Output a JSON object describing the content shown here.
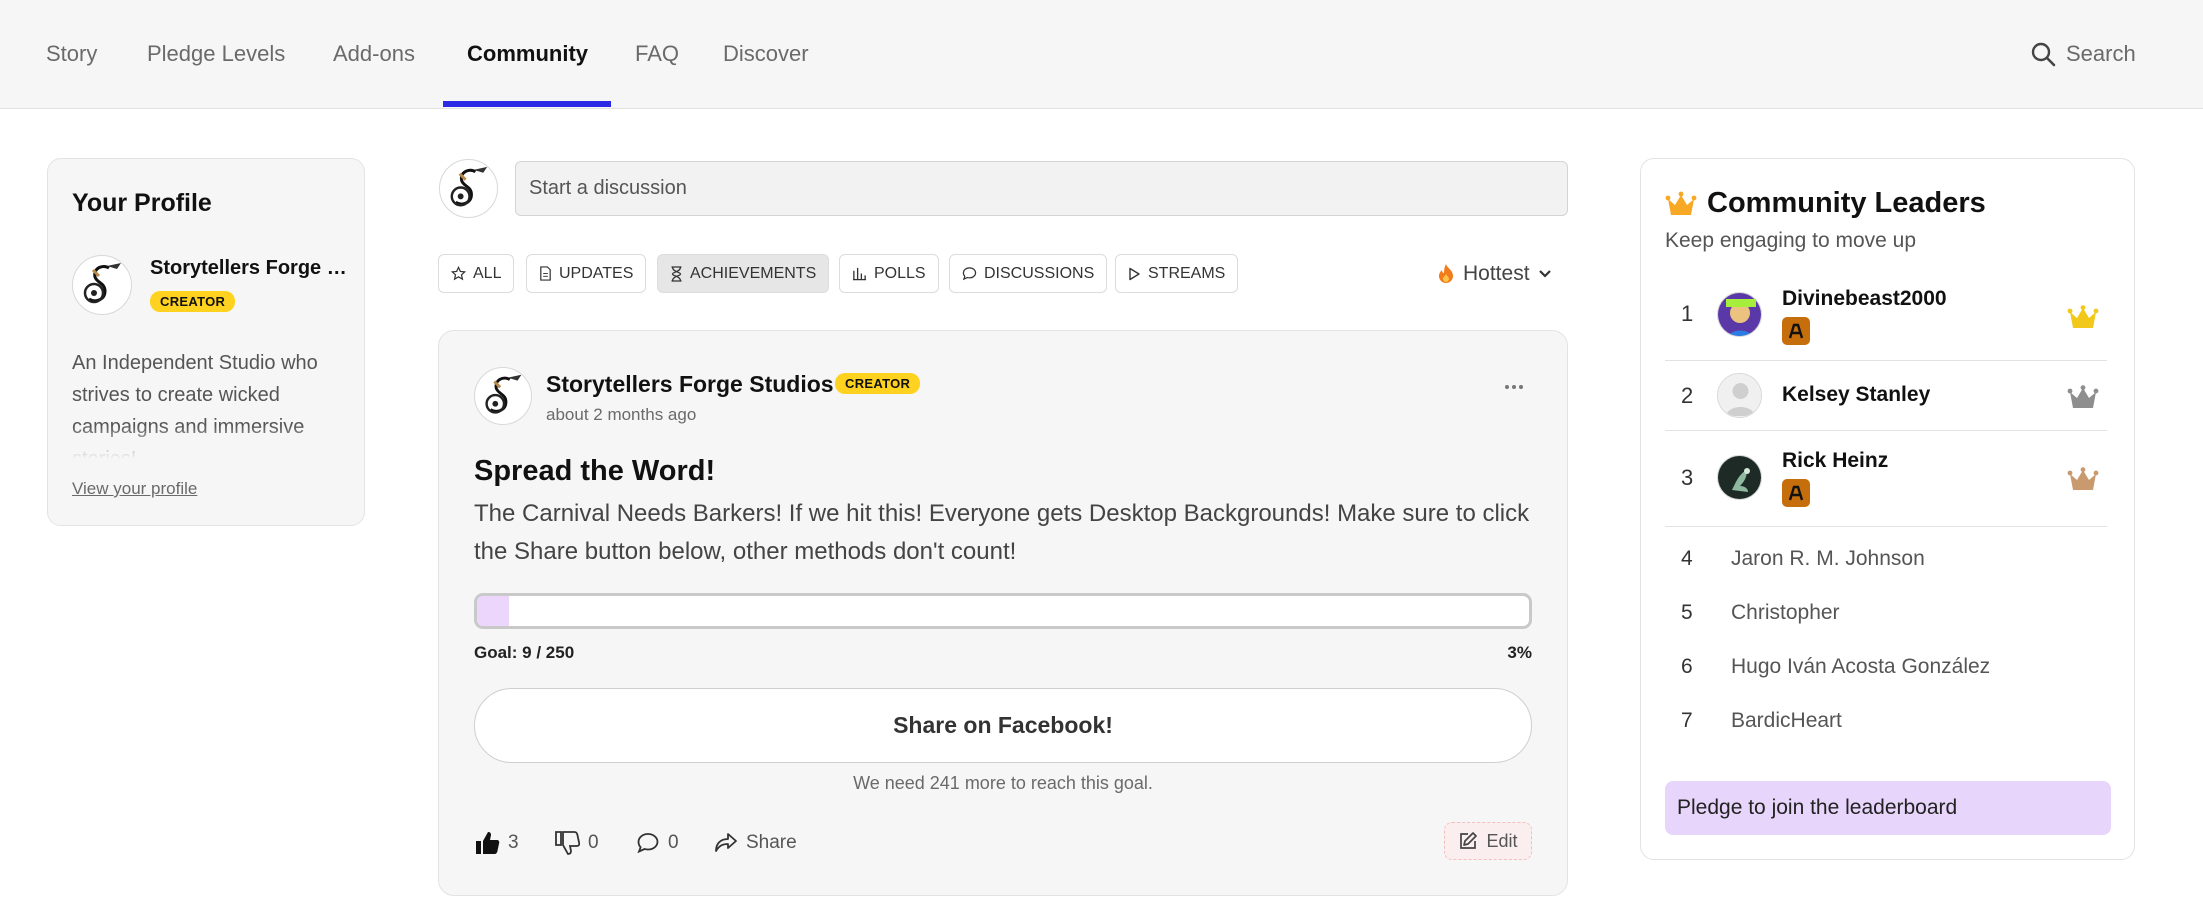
{
  "nav": {
    "tabs": [
      {
        "label": "Story"
      },
      {
        "label": "Pledge Levels"
      },
      {
        "label": "Add-ons"
      },
      {
        "label": "Community"
      },
      {
        "label": "FAQ"
      },
      {
        "label": "Discover"
      }
    ],
    "active_tab": "Community",
    "search_label": "Search",
    "accent_color": "#2b2be6"
  },
  "profile": {
    "title": "Your Profile",
    "name": "Storytellers Forge Studios",
    "badge": "CREATOR",
    "bio": "An Independent Studio who strives to create wicked campaigns and immersive stories!",
    "link": "View your profile"
  },
  "composer": {
    "placeholder": "Start a discussion"
  },
  "filters": [
    {
      "label": "ALL",
      "icon": "star-icon"
    },
    {
      "label": "UPDATES",
      "icon": "document-icon"
    },
    {
      "label": "ACHIEVEMENTS",
      "icon": "hourglass-icon"
    },
    {
      "label": "POLLS",
      "icon": "bar-chart-icon"
    },
    {
      "label": "DISCUSSIONS",
      "icon": "speech-bubble-icon"
    },
    {
      "label": "STREAMS",
      "icon": "play-icon"
    }
  ],
  "active_filter": "ACHIEVEMENTS",
  "sort": {
    "label": "Hottest",
    "icon": "flame-icon"
  },
  "post": {
    "author": "Storytellers Forge Studios",
    "badge": "CREATOR",
    "time": "about 2 months ago",
    "title": "Spread the Word!",
    "body": "The Carnival Needs Barkers! If we hit this! Everyone gets Desktop Backgrounds! Make sure to click the Share button below, other methods don't count!",
    "goal_text": "Goal: 9 / 250",
    "goal_current": 9,
    "goal_total": 250,
    "percent_label": "3%",
    "progress_fraction": 0.03,
    "button": "Share on Facebook!",
    "need_text": "We need 241 more to reach this goal.",
    "likes": "3",
    "dislikes": "0",
    "comments": "0",
    "share": "Share",
    "edit": "Edit",
    "progress_color": "#ecd6fb"
  },
  "leaders": {
    "title": "Community Leaders",
    "subtitle": "Keep engaging to move up",
    "top": [
      {
        "rank": "1",
        "name": "Divinebeast2000",
        "has_tier": true,
        "crown_color": "#f2c81b"
      },
      {
        "rank": "2",
        "name": "Kelsey Stanley",
        "has_tier": false,
        "crown_color": "#8e8e8e"
      },
      {
        "rank": "3",
        "name": "Rick Heinz",
        "has_tier": true,
        "crown_color": "#c99a6e"
      }
    ],
    "others": [
      {
        "rank": "4",
        "name": "Jaron R. M. Johnson"
      },
      {
        "rank": "5",
        "name": "Christopher"
      },
      {
        "rank": "6",
        "name": "Hugo Iván Acosta González"
      },
      {
        "rank": "7",
        "name": "BardicHeart"
      }
    ],
    "join": "Pledge to join the leaderboard",
    "join_color": "#e8d5fb"
  }
}
